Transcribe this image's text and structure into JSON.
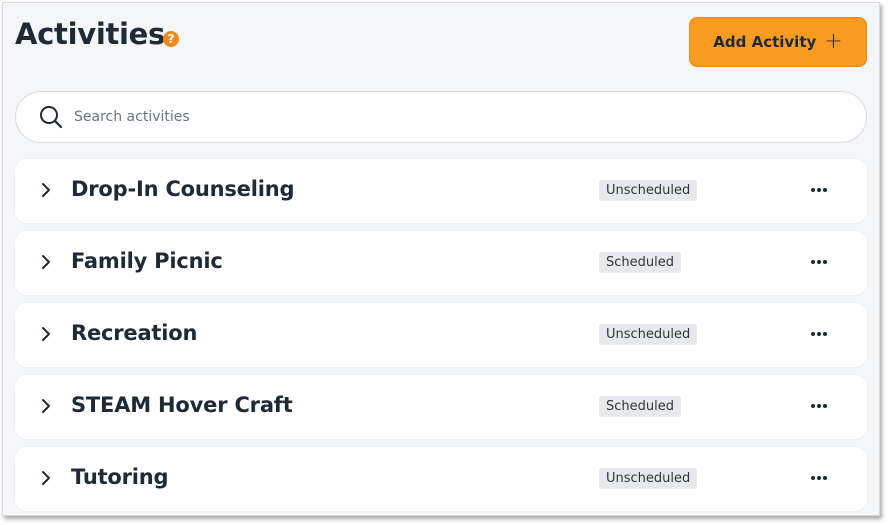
{
  "header": {
    "title": "Activities",
    "help_glyph": "?",
    "add_button": {
      "label": "Add Activity",
      "plus": "+"
    }
  },
  "search": {
    "placeholder": "Search activities",
    "value": ""
  },
  "activities": [
    {
      "name": "Drop-In Counseling",
      "status": "Unscheduled"
    },
    {
      "name": "Family Picnic",
      "status": "Scheduled"
    },
    {
      "name": "Recreation",
      "status": "Unscheduled"
    },
    {
      "name": "STEAM Hover Craft",
      "status": "Scheduled"
    },
    {
      "name": "Tutoring",
      "status": "Unscheduled"
    }
  ],
  "colors": {
    "accent": "#f99a22",
    "help_icon": "#f18a1d",
    "text_dark": "#1f2a36",
    "badge_bg": "#e7e9ec",
    "panel_bg": "#f5f6f8"
  },
  "icons": {
    "help": "help-icon",
    "add": "plus-icon",
    "search": "search-icon",
    "expand": "chevron-right-icon",
    "menu": "more-options-icon"
  }
}
